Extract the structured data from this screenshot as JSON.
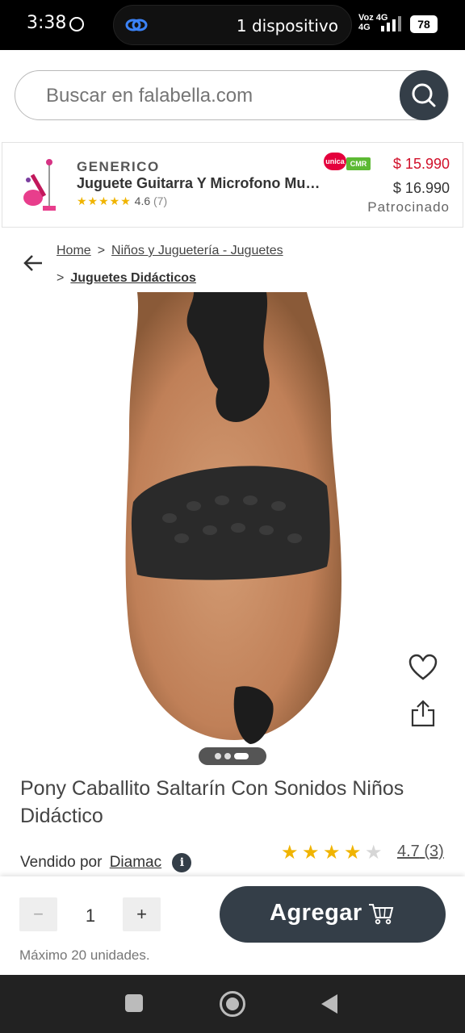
{
  "status": {
    "time": "3:38",
    "device_label": "1 dispositivo",
    "network": "Voz 4G",
    "network_line1": "Voz 4G",
    "network_line2": "4G",
    "battery": "78"
  },
  "search": {
    "placeholder": "Buscar en falabella.com"
  },
  "ad": {
    "brand": "GENERICO",
    "name": "Juguete Guitarra Y Microfono Mu…",
    "stars": "★★★★★",
    "rating": "4.6",
    "count": "(7)",
    "badge_unica": "unica",
    "badge_cmr": "CMR",
    "price_cmr": "$ 15.990",
    "price": "$ 16.990",
    "sponsored": "Patrocinado"
  },
  "breadcrumb": {
    "home": "Home",
    "sep": ">",
    "category": "Niños y Juguetería - Juguetes",
    "subcategory": "Juguetes Didácticos"
  },
  "product": {
    "title": "Pony Caballito Saltarín Con Sonidos Niños Didáctico",
    "seller_prefix": "Vendido por",
    "seller": "Diamac",
    "info": "i",
    "rating": "4.7",
    "review_count": "(3)",
    "rating_text": "4.7 (3)",
    "stars_filled": 4,
    "stars_total": 5,
    "image_index": 3,
    "image_total": 3
  },
  "footer": {
    "qty_minus": "−",
    "quantity": "1",
    "qty_plus": "+",
    "add_label": "Agregar",
    "max_note": "Máximo 20 unidades."
  },
  "colors": {
    "primary_dark": "#343e48",
    "price_red": "#d1102a",
    "star": "#f0b400"
  }
}
